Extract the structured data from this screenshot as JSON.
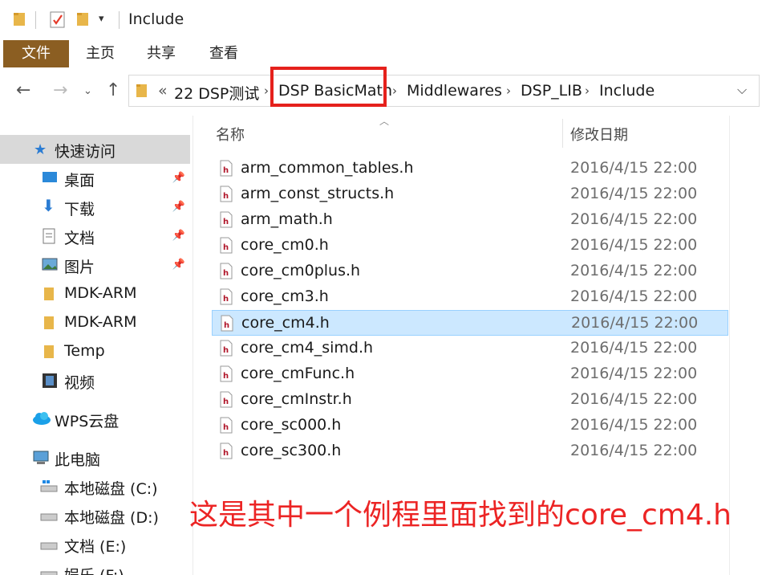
{
  "window": {
    "title": "Include"
  },
  "ribbon": {
    "tabs": [
      "文件",
      "主页",
      "共享",
      "查看"
    ]
  },
  "address": {
    "overflow": "«",
    "crumbs": [
      "22 DSP测试",
      "DSP BasicMath",
      "Middlewares",
      "DSP_LIB",
      "Include"
    ]
  },
  "nav": {
    "quick_access": "快速访问",
    "pinned": [
      "桌面",
      "下载",
      "文档",
      "图片"
    ],
    "folders": [
      "MDK-ARM",
      "MDK-ARM",
      "Temp",
      "视频"
    ],
    "wps": "WPS云盘",
    "this_pc": "此电脑",
    "drives": [
      "本地磁盘 (C:)",
      "本地磁盘 (D:)",
      "文档 (E:)",
      "娱乐 (F:)"
    ]
  },
  "columns": {
    "name": "名称",
    "modified": "修改日期"
  },
  "files": [
    {
      "name": "arm_common_tables.h",
      "date": "2016/4/15 22:00"
    },
    {
      "name": "arm_const_structs.h",
      "date": "2016/4/15 22:00"
    },
    {
      "name": "arm_math.h",
      "date": "2016/4/15 22:00"
    },
    {
      "name": "core_cm0.h",
      "date": "2016/4/15 22:00"
    },
    {
      "name": "core_cm0plus.h",
      "date": "2016/4/15 22:00"
    },
    {
      "name": "core_cm3.h",
      "date": "2016/4/15 22:00"
    },
    {
      "name": "core_cm4.h",
      "date": "2016/4/15 22:00"
    },
    {
      "name": "core_cm4_simd.h",
      "date": "2016/4/15 22:00"
    },
    {
      "name": "core_cmFunc.h",
      "date": "2016/4/15 22:00"
    },
    {
      "name": "core_cmInstr.h",
      "date": "2016/4/15 22:00"
    },
    {
      "name": "core_sc000.h",
      "date": "2016/4/15 22:00"
    },
    {
      "name": "core_sc300.h",
      "date": "2016/4/15 22:00"
    }
  ],
  "selected_file": "core_cm4.h",
  "annotation": "这是其中一个例程里面找到的core_cm4.h",
  "colors": {
    "file_tab": "#8b5e22",
    "selection": "#cce8ff",
    "highlight": "#e5211c",
    "annotation": "#ec2424"
  }
}
